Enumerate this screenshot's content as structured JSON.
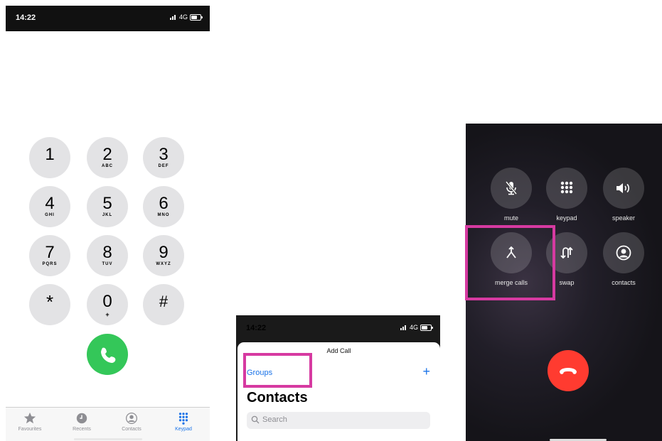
{
  "colors": {
    "accent_blue": "#1a73e8",
    "call_green": "#34c759",
    "end_red": "#ff3b30",
    "highlight_magenta": "#d63aa1"
  },
  "phone1": {
    "status": {
      "time": "14:22",
      "network": "4G"
    },
    "keys": [
      {
        "num": "1",
        "letters": ""
      },
      {
        "num": "2",
        "letters": "ABC"
      },
      {
        "num": "3",
        "letters": "DEF"
      },
      {
        "num": "4",
        "letters": "GHI"
      },
      {
        "num": "5",
        "letters": "JKL"
      },
      {
        "num": "6",
        "letters": "MNO"
      },
      {
        "num": "7",
        "letters": "PQRS"
      },
      {
        "num": "8",
        "letters": "TUV"
      },
      {
        "num": "9",
        "letters": "WXYZ"
      },
      {
        "num": "*",
        "letters": ""
      },
      {
        "num": "0",
        "letters": "+"
      },
      {
        "num": "#",
        "letters": ""
      }
    ],
    "call_icon": "phone-icon",
    "tabs": [
      {
        "label": "Favourites",
        "icon": "star-icon",
        "active": false
      },
      {
        "label": "Recents",
        "icon": "clock-icon",
        "active": false
      },
      {
        "label": "Contacts",
        "icon": "person-circle-icon",
        "active": false
      },
      {
        "label": "Keypad",
        "icon": "keypad-icon",
        "active": true
      }
    ]
  },
  "phone2": {
    "status": {
      "time": "14:22",
      "network": "4G"
    },
    "sheet_title": "Add Call",
    "groups_label": "Groups",
    "add_label": "+",
    "heading": "Contacts",
    "search_placeholder": "Search"
  },
  "phone3": {
    "buttons": [
      {
        "label": "mute",
        "icon": "mic-off-icon"
      },
      {
        "label": "keypad",
        "icon": "keypad-icon"
      },
      {
        "label": "speaker",
        "icon": "speaker-icon"
      },
      {
        "label": "merge calls",
        "icon": "merge-icon"
      },
      {
        "label": "swap",
        "icon": "swap-icon"
      },
      {
        "label": "contacts",
        "icon": "person-circle-icon"
      }
    ],
    "end_call_icon": "end-call-icon"
  }
}
